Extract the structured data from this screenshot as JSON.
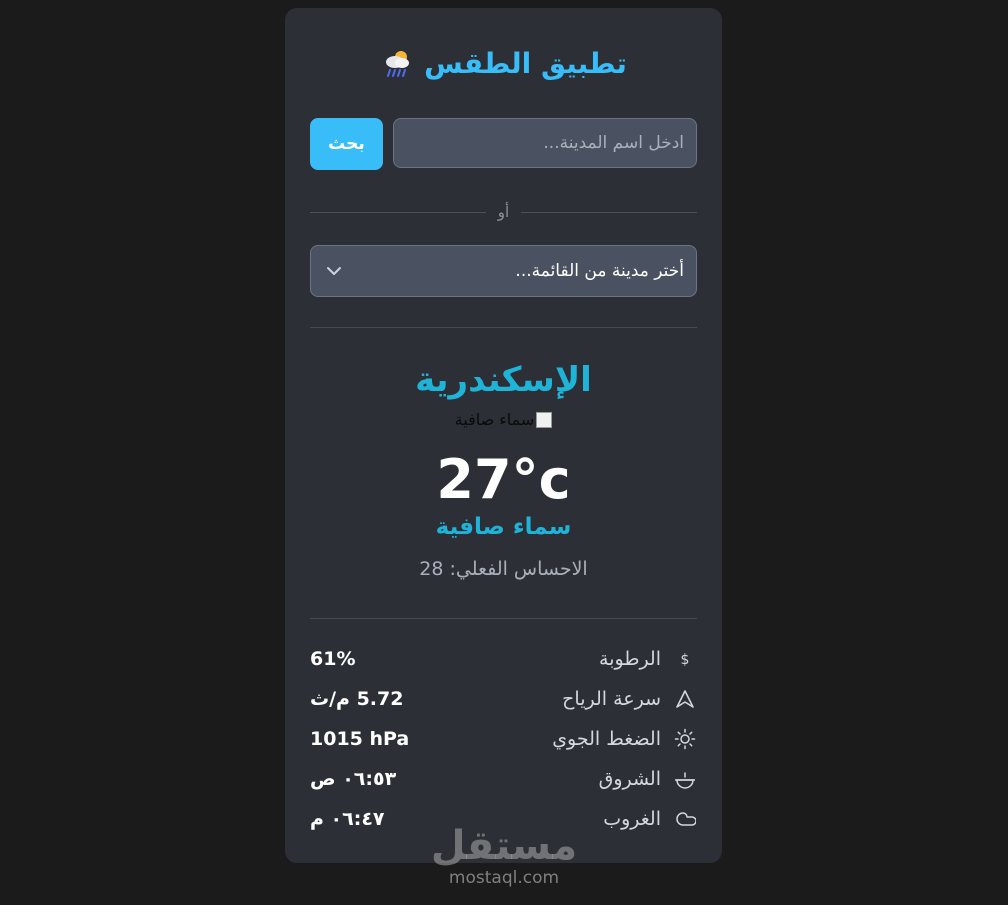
{
  "header": {
    "title": "تطبيق الطقس",
    "icon": "cloud-rain-sun-icon"
  },
  "search": {
    "placeholder": "ادخل اسم المدينة...",
    "value": "",
    "button_label": "بحث"
  },
  "divider": {
    "or_text": "أو"
  },
  "city_select": {
    "selected": "أختر مدينة من القائمة...",
    "icon": "chevron-down-icon"
  },
  "weather": {
    "city": "الإسكندرية",
    "image_alt": "سماء صافية",
    "temperature": "27°c",
    "description": "سماء صافية",
    "feels_like": "الاحساس الفعلي: 28"
  },
  "details": [
    {
      "icon": "humidity-icon",
      "label": "الرطوبة",
      "value": "61%"
    },
    {
      "icon": "wind-icon",
      "label": "سرعة الرياح",
      "value": "5.72 م/ث"
    },
    {
      "icon": "sun-icon",
      "label": "الضغط الجوي",
      "value": "1015 hPa"
    },
    {
      "icon": "sunrise-icon",
      "label": "الشروق",
      "value": "٠٦:٥٣ ص"
    },
    {
      "icon": "sunset-icon",
      "label": "الغروب",
      "value": "٠٦:٤٧ م"
    }
  ],
  "watermark": {
    "arabic": "مستقل",
    "latin": "mostaql.com"
  },
  "colors": {
    "accent": "#38bdf8",
    "city": "#1fb3d8",
    "card": "#2c2f36",
    "background": "#1b1b1c"
  }
}
